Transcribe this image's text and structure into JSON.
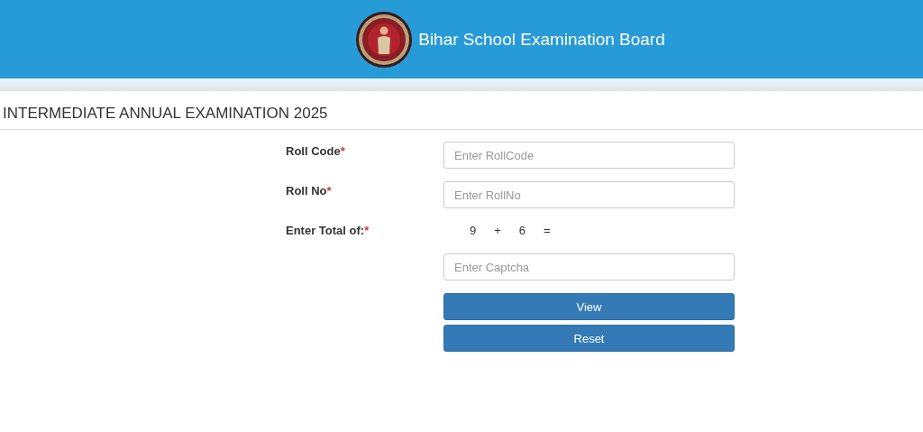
{
  "header": {
    "title": "Bihar School Examination Board"
  },
  "page_title": "INTERMEDIATE ANNUAL EXAMINATION 2025",
  "form": {
    "fields": [
      {
        "kind": "input",
        "label": "Roll Code",
        "required_mark": "*",
        "placeholder": "Enter RollCode"
      },
      {
        "kind": "input",
        "label": "Roll No",
        "required_mark": "*",
        "placeholder": "Enter RollNo"
      },
      {
        "kind": "captcha",
        "label": "Enter Total of:",
        "required_mark": "*",
        "terms": [
          "9",
          "+",
          "6",
          "="
        ],
        "placeholder": "Enter Captcha"
      }
    ],
    "buttons": [
      "View",
      "Reset"
    ]
  }
}
